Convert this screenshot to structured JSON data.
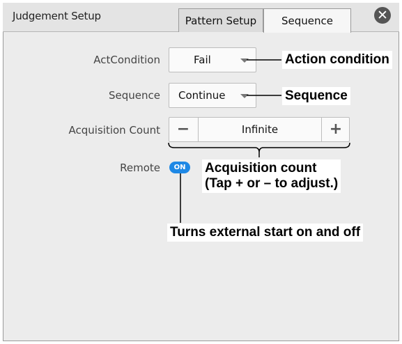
{
  "header": {
    "title": "Judgement Setup",
    "tabs": [
      {
        "label": "Pattern Setup",
        "active": false
      },
      {
        "label": "Sequence",
        "active": true
      }
    ],
    "close_icon": "close-icon",
    "close_glyph": "✕"
  },
  "form": {
    "act_condition": {
      "label": "ActCondition",
      "value": "Fail"
    },
    "sequence": {
      "label": "Sequence",
      "value": "Continue"
    },
    "acquisition_count": {
      "label": "Acquisition Count",
      "value": "Infinite",
      "minus": "−",
      "plus": "+"
    },
    "remote": {
      "label": "Remote",
      "state": "ON"
    }
  },
  "callouts": {
    "action_condition": "Action condition",
    "sequence": "Sequence",
    "acquisition_count_line1": "Acquisition count",
    "acquisition_count_line2": "(Tap + or – to adjust.)",
    "remote": "Turns external start on and off"
  },
  "colors": {
    "toggle_on": "#1e88e5",
    "panel": "#ececec"
  }
}
